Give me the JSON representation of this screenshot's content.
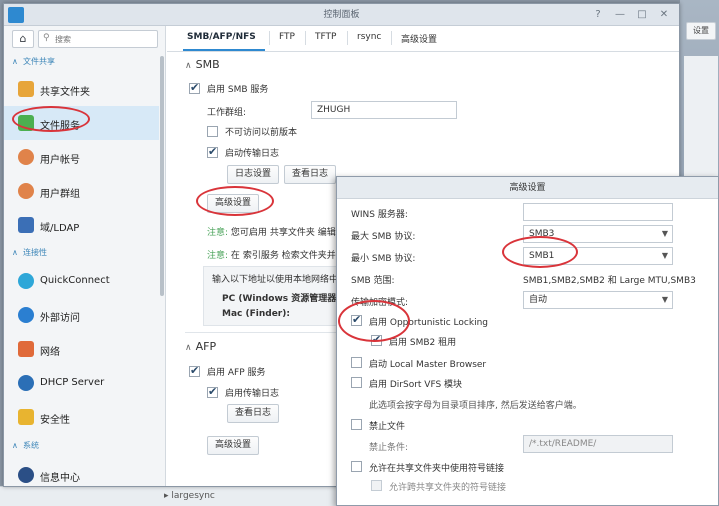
{
  "window": {
    "title": "控制面板"
  },
  "sidebar": {
    "search_placeholder": "搜索",
    "section_file_sharing": "文件共享",
    "section_connectivity": "连接性",
    "section_system": "系统",
    "items": [
      {
        "label": "共享文件夹",
        "icon": "folder-icon",
        "color": "#e7a53a"
      },
      {
        "label": "文件服务",
        "icon": "file-service-icon",
        "color": "#4caf50"
      },
      {
        "label": "用户帐号",
        "icon": "user-icon",
        "color": "#e0834a"
      },
      {
        "label": "用户群组",
        "icon": "group-icon",
        "color": "#e0834a"
      },
      {
        "label": "域/LDAP",
        "icon": "domain-icon",
        "color": "#3b6fb6"
      },
      {
        "label": "QuickConnect",
        "icon": "quickconnect-icon",
        "color": "#2ea7d8"
      },
      {
        "label": "外部访问",
        "icon": "globe-icon",
        "color": "#2b7fd1"
      },
      {
        "label": "网络",
        "icon": "house-network-icon",
        "color": "#e06a3a"
      },
      {
        "label": "DHCP Server",
        "icon": "dhcp-icon",
        "color": "#2b6fb6"
      },
      {
        "label": "安全性",
        "icon": "shield-icon",
        "color": "#e8b430"
      },
      {
        "label": "信息中心",
        "icon": "info-icon",
        "color": "#2b4f86"
      }
    ]
  },
  "tabs": [
    "SMB/AFP/NFS",
    "FTP",
    "TFTP",
    "rsync",
    "高级设置"
  ],
  "smb": {
    "title": "SMB",
    "enable_label": "启用 SMB 服务",
    "workgroup_label": "工作群组:",
    "workgroup_value": "ZHUGH",
    "hide_prev_label": "不可访问以前版本",
    "transfer_log_label": "启动传输日志",
    "log_settings_btn": "日志设置",
    "view_log_btn": "查看日志",
    "advanced_btn": "高级设置",
    "note1_prefix": "注意:",
    "note1_text": "您可启用",
    "note1_link": "共享文件夹",
    "note1_suffix": "编辑页",
    "note2_prefix": "注意:",
    "note2_text": "在",
    "note2_link": "索引服务",
    "note2_suffix": "检索文件夹并解",
    "info_text": "输入以下地址以使用本地网络中的",
    "pc_label": "PC (Windows 资源管理器):",
    "mac_label": "Mac (Finder):"
  },
  "afp": {
    "title": "AFP",
    "enable_label": "启用 AFP 服务",
    "transfer_log_label": "启用传输日志",
    "view_log_btn": "查看日志",
    "advanced_btn": "高级设置"
  },
  "dialog": {
    "title": "高级设置",
    "wins_label": "WINS 服务器:",
    "max_smb_label": "最大 SMB 协议:",
    "max_smb_value": "SMB3",
    "min_smb_label": "最小 SMB 协议:",
    "min_smb_value": "SMB1",
    "smb_range_label": "SMB 范围:",
    "smb_range_value": "SMB1,SMB2,SMB2 和 Large MTU,SMB3",
    "transport_label": "传输加密模式:",
    "transport_value": "自动",
    "oplock_label": "启用 Opportunistic Locking",
    "smb2_lease_label": "启用 SMB2 租用",
    "local_master_label": "启动 Local Master Browser",
    "dirsort_label": "启用 DirSort VFS 模块",
    "dirsort_desc": "此选项会按字母为目录项目排序, 然后发送给客户端。",
    "veto_label": "禁止文件",
    "veto_cond_label": "禁止条件:",
    "veto_cond_value": "/*.txt/README/",
    "symlink_label": "允许在共享文件夹中使用符号链接",
    "symlink_cross_label": "允许跨共享文件夹的符号链接"
  },
  "background": {
    "settings_btn": "设置",
    "bottom_item": "largesync"
  }
}
